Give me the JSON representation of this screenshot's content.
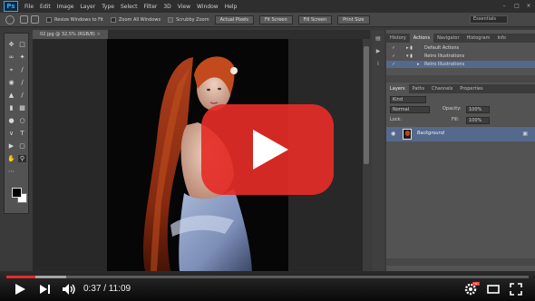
{
  "photoshop": {
    "logo": "Ps",
    "menu": [
      "File",
      "Edit",
      "Image",
      "Layer",
      "Type",
      "Select",
      "Filter",
      "3D",
      "View",
      "Window",
      "Help"
    ],
    "options_bar": {
      "resize_windows": "Resize Windows to Fit",
      "zoom_all": "Zoom All Windows",
      "scrubby_zoom": "Scrubby Zoom",
      "buttons": [
        "Actual Pixels",
        "Fit Screen",
        "Fill Screen",
        "Print Size"
      ],
      "workspace": "Essentials"
    },
    "document_tab": "02.jpg @ 32,5% (RGB/8)",
    "panels": {
      "top_tabs": [
        "History",
        "Actions",
        "Navigator",
        "Histogram",
        "Info"
      ],
      "actions": [
        "Default Actions",
        "Retro Illustrations",
        "Retro Illustrations"
      ],
      "layers_tabs": [
        "Layers",
        "Paths",
        "Channels",
        "Properties"
      ],
      "kind": "Kind",
      "blend_mode": "Normal",
      "opacity_label": "Opacity:",
      "opacity_value": "100%",
      "fill_label": "Fill:",
      "fill_value": "100%",
      "lock_label": "Lock:",
      "layer_name": "Background"
    }
  },
  "player": {
    "current_time": "0:37",
    "duration": "11:09",
    "time_text": "0:37 / 11:09",
    "played_fraction": 0.056,
    "buffered_fraction": 0.115,
    "hd_label": "HD",
    "accent_color": "#e52d27"
  }
}
